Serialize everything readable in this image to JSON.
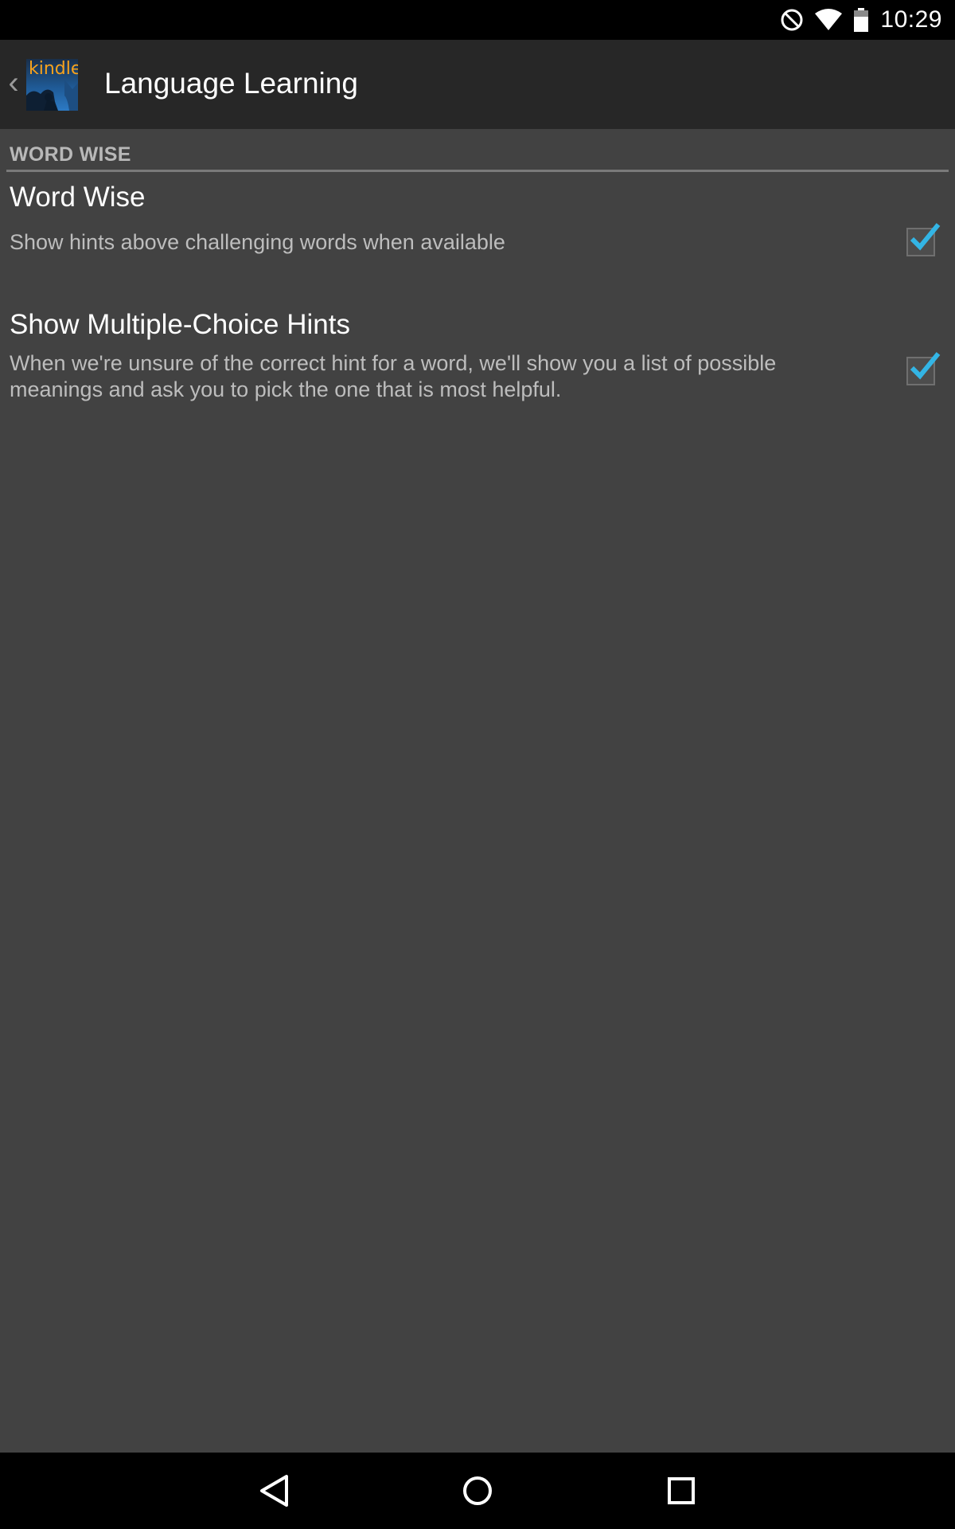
{
  "status_bar": {
    "time": "10:29",
    "icons": [
      "do-not-disturb-icon",
      "wifi-icon",
      "battery-icon"
    ]
  },
  "action_bar": {
    "back_icon": "chevron-left-icon",
    "app_icon_text": "kindle",
    "title": "Language Learning"
  },
  "settings": {
    "section_header": "WORD WISE",
    "items": [
      {
        "title": "Word Wise",
        "summary": "Show hints above challenging words when available",
        "checked": true
      },
      {
        "title": "Show Multiple-Choice Hints",
        "summary": "When we're unsure of the correct hint for a word, we'll show you a list of possible meanings and ask you to pick the one that is most helpful.",
        "checked": true
      }
    ]
  },
  "nav_bar": {
    "buttons": [
      "back-icon",
      "home-icon",
      "recents-icon"
    ]
  },
  "colors": {
    "accent": "#33b5e5",
    "background": "#424242",
    "action_bar": "#272727"
  }
}
